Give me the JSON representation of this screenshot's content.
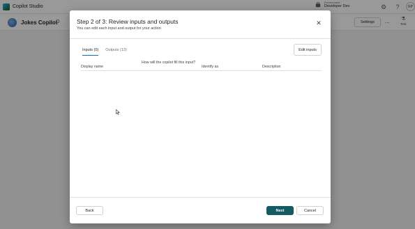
{
  "app": {
    "title": "Copilot Studio"
  },
  "environment": {
    "label": "Environment",
    "value": "Developer Dev"
  },
  "user": {
    "initials": "RP"
  },
  "copilot": {
    "name": "Jokes Copilot",
    "status_char": "O"
  },
  "toolbar": {
    "settings_label": "Settings",
    "more_label": "...",
    "test_label": "Test"
  },
  "dialog": {
    "title": "Step 2 of 3: Review inputs and outputs",
    "subtitle": "You can edit each input and output for your action",
    "tabs": [
      {
        "label": "Inputs (0)",
        "active": true
      },
      {
        "label": "Outputs (13)",
        "active": false
      }
    ],
    "edit_inputs_label": "Edit inputs",
    "columns": [
      "Display name",
      "How will the copilot fill this input?",
      "Identify as",
      "Description"
    ],
    "back_label": "Back",
    "next_label": "Next",
    "cancel_label": "Cancel"
  },
  "colors": {
    "accent": "#0f6cbd",
    "primary_button": "#135b63"
  },
  "icons": [
    "copilot-studio-logo-icon",
    "environment-icon",
    "gear-icon",
    "help-icon",
    "bot-avatar-icon",
    "test-icon",
    "close-icon",
    "cursor-icon"
  ]
}
